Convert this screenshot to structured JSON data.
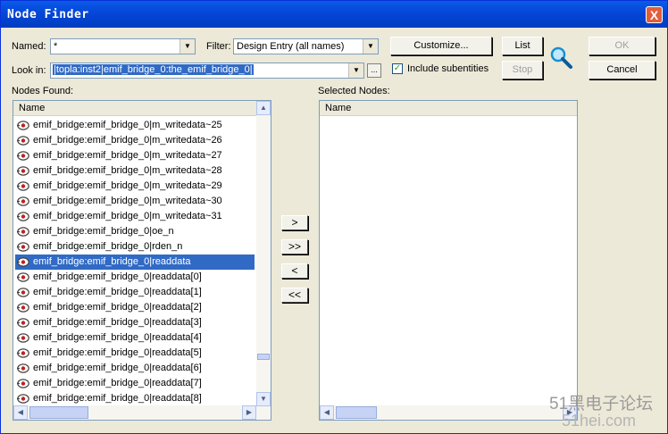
{
  "window": {
    "title": "Node Finder",
    "close_symbol": "X"
  },
  "named": {
    "label": "Named:",
    "value": "*"
  },
  "filter": {
    "label": "Filter:",
    "value": "Design Entry (all names)"
  },
  "look_in": {
    "label": "Look in:",
    "value": "|topla:inst2|emif_bridge_0:the_emif_bridge_0|",
    "browse_label": "..."
  },
  "include_subentities": {
    "label": "Include subentities",
    "checked": true,
    "mark": "✓"
  },
  "buttons": {
    "customize": "Customize...",
    "list": "List",
    "stop": "Stop",
    "ok": "OK",
    "cancel": "Cancel"
  },
  "nodes_found": {
    "label": "Nodes Found:",
    "column": "Name",
    "rows": [
      "emif_bridge:emif_bridge_0|m_writedata~25",
      "emif_bridge:emif_bridge_0|m_writedata~26",
      "emif_bridge:emif_bridge_0|m_writedata~27",
      "emif_bridge:emif_bridge_0|m_writedata~28",
      "emif_bridge:emif_bridge_0|m_writedata~29",
      "emif_bridge:emif_bridge_0|m_writedata~30",
      "emif_bridge:emif_bridge_0|m_writedata~31",
      "emif_bridge:emif_bridge_0|oe_n",
      "emif_bridge:emif_bridge_0|rden_n",
      "emif_bridge:emif_bridge_0|readdata",
      "emif_bridge:emif_bridge_0|readdata[0]",
      "emif_bridge:emif_bridge_0|readdata[1]",
      "emif_bridge:emif_bridge_0|readdata[2]",
      "emif_bridge:emif_bridge_0|readdata[3]",
      "emif_bridge:emif_bridge_0|readdata[4]",
      "emif_bridge:emif_bridge_0|readdata[5]",
      "emif_bridge:emif_bridge_0|readdata[6]",
      "emif_bridge:emif_bridge_0|readdata[7]",
      "emif_bridge:emif_bridge_0|readdata[8]"
    ],
    "selected": "emif_bridge:emif_bridge_0|readdata"
  },
  "transfer": {
    "add": ">",
    "add_all": ">>",
    "remove": "<",
    "remove_all": "<<"
  },
  "selected_nodes": {
    "label": "Selected Nodes:",
    "column": "Name"
  },
  "watermark": {
    "line1": "51黑电子论坛",
    "line2": "51hei.com"
  },
  "icons": {
    "close": "close-icon",
    "dropdown": "chevron-down-icon",
    "search": "magnifier-icon",
    "node": "node-pin-icon"
  },
  "colors": {
    "title_bar": "#0546d8",
    "selection": "#316ac5",
    "dialog_bg": "#ece9d8"
  }
}
